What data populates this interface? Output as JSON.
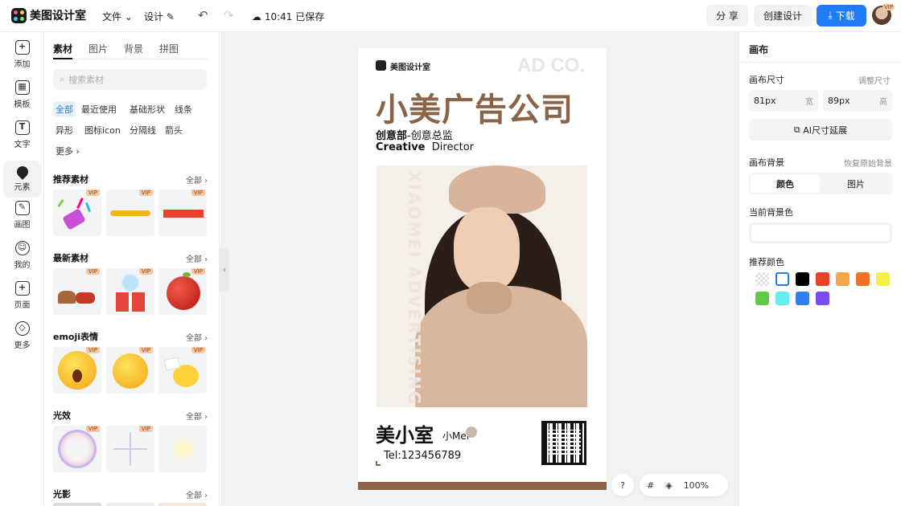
{
  "app": {
    "name": "美图设计室"
  },
  "topbar": {
    "file_menu": "文件",
    "design_menu": "设计",
    "save_status": "10:41 已保存",
    "share_label": "分 享",
    "create_label": "创建设计",
    "download_label": "下载",
    "vip_badge": "VIP"
  },
  "leftnav": {
    "items": [
      {
        "label": "添加",
        "glyph": "+"
      },
      {
        "label": "模板",
        "glyph": "▦"
      },
      {
        "label": "文字",
        "glyph": "T"
      },
      {
        "label": "元素",
        "glyph": ""
      },
      {
        "label": "画图",
        "glyph": "✎"
      },
      {
        "label": "我的",
        "glyph": "☺"
      },
      {
        "label": "页面",
        "glyph": "+"
      },
      {
        "label": "更多",
        "glyph": "◇"
      }
    ]
  },
  "panel": {
    "tabs": [
      "素材",
      "图片",
      "背景",
      "拼图"
    ],
    "search_placeholder": "搜索素材",
    "chips": [
      "全部",
      "最近使用",
      "基础形状",
      "线条",
      "异形",
      "图标icon",
      "分隔线",
      "箭头",
      "更多"
    ],
    "all_label": "全部",
    "vip_label": "VIP",
    "sections": [
      {
        "title": "推荐素材"
      },
      {
        "title": "最新素材"
      },
      {
        "title": "emoji表情"
      },
      {
        "title": "光效"
      },
      {
        "title": "光影"
      }
    ]
  },
  "card": {
    "logo_text": "美图设计室",
    "watermark": "AD CO.",
    "company": "小美广告公司",
    "dept_cn": "创意部",
    "role_cn": "-创意总监",
    "dept_en": "Creative",
    "role_en": "Director",
    "vertical_text": "XIAOMEI ADVERTISING",
    "name_cn": "美小室",
    "name_en": "小Mei",
    "tel": "Tel:123456789"
  },
  "bottom_tools": {
    "help": "?",
    "zoom": "100%"
  },
  "right_panel": {
    "title": "画布",
    "size_label": "画布尺寸",
    "resize_label": "调整尺寸",
    "width_value": "81px",
    "width_unit": "宽",
    "height_value": "89px",
    "height_unit": "高",
    "ai_extend": "AI尺寸延展",
    "bg_label": "画布背景",
    "restore_bg": "恢复原始背景",
    "bg_tab_color": "颜色",
    "bg_tab_image": "图片",
    "current_bg_label": "当前背景色",
    "recommend_label": "推荐颜色",
    "recommend_colors": [
      "transparent",
      "#ffffff",
      "#000000",
      "#e8412c",
      "#f3a74a",
      "#ec7426",
      "#f5ee45",
      "#5fcb45",
      "#63eef0",
      "#2f7ef5",
      "#7c4cf0"
    ]
  },
  "colors": {
    "brand_blue": "#1f7cf4",
    "card_brown": "#8b6346"
  }
}
